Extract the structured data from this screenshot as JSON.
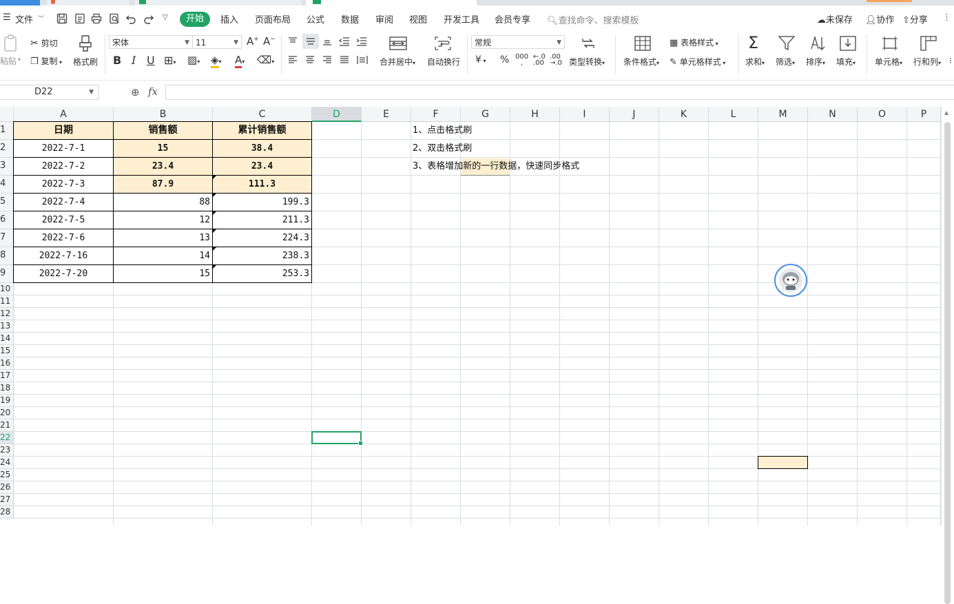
{
  "menu": {
    "file": "文件",
    "tabs": [
      "开始",
      "插入",
      "页面布局",
      "公式",
      "数据",
      "审阅",
      "视图",
      "开发工具",
      "会员专享"
    ],
    "search_placeholder": "查找命令、搜索模板",
    "unsaved": "未保存",
    "collab": "协作",
    "share": "分享"
  },
  "ribbon": {
    "paste": "粘贴",
    "cut": "剪切",
    "copy": "复制",
    "format_painter": "格式刷",
    "font_name": "宋体",
    "font_size": "11",
    "merge_center": "合并居中",
    "wrap_text": "自动换行",
    "number_format": "常规",
    "type_convert": "类型转换",
    "conditional_format": "条件格式",
    "table_style": "表格样式",
    "cell_style": "单元格样式",
    "sum": "求和",
    "filter": "筛选",
    "sort": "排序",
    "fill": "填充",
    "cell": "单元格",
    "row_col": "行和列"
  },
  "formula_bar": {
    "cell_ref": "D22",
    "fx": "fx",
    "value": ""
  },
  "sheet": {
    "columns": [
      "A",
      "B",
      "C",
      "D",
      "E",
      "F",
      "G",
      "H",
      "I",
      "J",
      "K",
      "L",
      "M",
      "N",
      "O",
      "P"
    ],
    "rows": [
      "1",
      "2",
      "3",
      "4",
      "5",
      "6",
      "7",
      "8",
      "9",
      "10",
      "11",
      "12",
      "13",
      "14",
      "15",
      "16",
      "17",
      "18",
      "19",
      "20",
      "21",
      "22",
      "23",
      "24",
      "25",
      "26",
      "27",
      "28"
    ],
    "selected_col": "D",
    "selected_row": "22",
    "headers": {
      "a": "日期",
      "b": "销售额",
      "c": "累计销售额"
    },
    "data": [
      {
        "date": "2022-7-1",
        "sales": "15",
        "cum": "38.4"
      },
      {
        "date": "2022-7-2",
        "sales": "23.4",
        "cum": "23.4"
      },
      {
        "date": "2022-7-3",
        "sales": "87.9",
        "cum": "111.3"
      },
      {
        "date": "2022-7-4",
        "sales": "88",
        "cum": "199.3"
      },
      {
        "date": "2022-7-5",
        "sales": "12",
        "cum": "211.3"
      },
      {
        "date": "2022-7-6",
        "sales": "13",
        "cum": "224.3"
      },
      {
        "date": "2022-7-16",
        "sales": "14",
        "cum": "238.3"
      },
      {
        "date": "2022-7-20",
        "sales": "15",
        "cum": "253.3"
      }
    ],
    "notes": [
      "1、点击格式刷",
      "2、双击格式刷",
      "3、表格增加新的一行数据，快速同步格式"
    ]
  },
  "colors": {
    "accent": "#21a366",
    "header_fill": "#fdefcf"
  }
}
